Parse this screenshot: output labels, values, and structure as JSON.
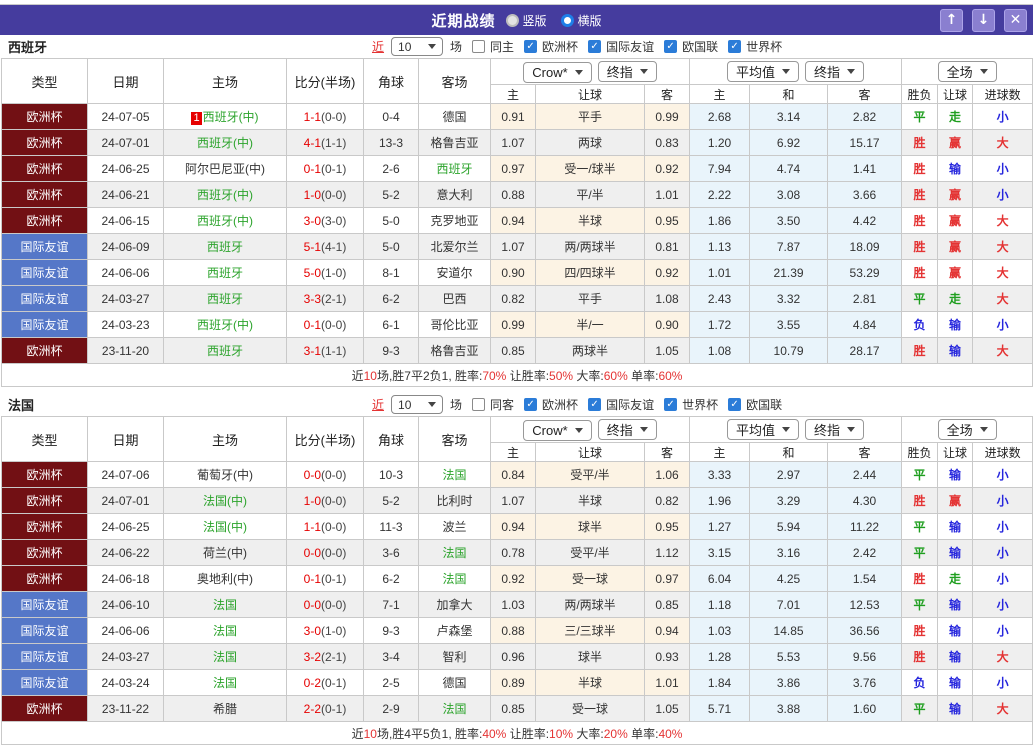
{
  "titlebar": {
    "title": "近期战绩",
    "radio1": "竖版",
    "radio2": "横版"
  },
  "icons": {
    "up": "↑",
    "down": "↓",
    "close": "✕",
    "check": "✓"
  },
  "colors": {
    "titlebar_purple": "#453C9E",
    "euro_type_maroon": "#721014",
    "friendly_type_blue": "#5577C8",
    "win_red": "#E43333",
    "draw_green": "#1E9E1E",
    "lose_blue": "#2626DD",
    "team_green": "#2BA32B",
    "score_red": "#E60000",
    "crow_col_bg": "#FCF3E4",
    "avg_col_bg": "#E9F4FB",
    "checkbox_blue": "#2B7CD8"
  },
  "table_header": {
    "main": [
      "类型",
      "日期",
      "主场",
      "比分(半场)",
      "角球",
      "客场"
    ],
    "sub": [
      "主",
      "让球",
      "客",
      "主",
      "和",
      "客",
      "胜负",
      "让球",
      "进球数"
    ],
    "dd_crow": "Crow*",
    "dd_final1": "终指",
    "dd_avg": "平均值",
    "dd_final2": "终指",
    "dd_full": "全场"
  },
  "sections": [
    {
      "team": "西班牙",
      "filter": {
        "near": "近",
        "count": "10",
        "unit": "场",
        "same": "同主",
        "leagues": [
          "欧洲杯",
          "国际友谊",
          "欧国联",
          "世界杯"
        ]
      },
      "rows": [
        {
          "type": "欧洲杯",
          "date": "24-07-05",
          "badge": "1",
          "home": "西班牙(中)",
          "hg": true,
          "ft": "1-1",
          "ht": "(0-0)",
          "corner": "0-4",
          "away": "德国",
          "ag": false,
          "o1": "0.91",
          "hc": "平手",
          "o2": "0.99",
          "a1": "2.68",
          "a2": "3.14",
          "a3": "2.82",
          "r1": "平",
          "r2": "走",
          "r3": "小"
        },
        {
          "type": "欧洲杯",
          "date": "24-07-01",
          "home": "西班牙(中)",
          "hg": true,
          "ft": "4-1",
          "ht": "(1-1)",
          "corner": "13-3",
          "away": "格鲁吉亚",
          "ag": false,
          "o1": "1.07",
          "hc": "两球",
          "o2": "0.83",
          "a1": "1.20",
          "a2": "6.92",
          "a3": "15.17",
          "r1": "胜",
          "r2": "赢",
          "r3": "大"
        },
        {
          "type": "欧洲杯",
          "date": "24-06-25",
          "home": "阿尔巴尼亚(中)",
          "hg": false,
          "ft": "0-1",
          "ht": "(0-1)",
          "corner": "2-6",
          "away": "西班牙",
          "ag": true,
          "o1": "0.97",
          "hc": "受一/球半",
          "o2": "0.92",
          "a1": "7.94",
          "a2": "4.74",
          "a3": "1.41",
          "r1": "胜",
          "r2": "输",
          "r3": "小"
        },
        {
          "type": "欧洲杯",
          "date": "24-06-21",
          "home": "西班牙(中)",
          "hg": true,
          "ft": "1-0",
          "ht": "(0-0)",
          "corner": "5-2",
          "away": "意大利",
          "ag": false,
          "o1": "0.88",
          "hc": "平/半",
          "o2": "1.01",
          "a1": "2.22",
          "a2": "3.08",
          "a3": "3.66",
          "r1": "胜",
          "r2": "赢",
          "r3": "小"
        },
        {
          "type": "欧洲杯",
          "date": "24-06-15",
          "home": "西班牙(中)",
          "hg": true,
          "ft": "3-0",
          "ht": "(3-0)",
          "corner": "5-0",
          "away": "克罗地亚",
          "ag": false,
          "o1": "0.94",
          "hc": "半球",
          "o2": "0.95",
          "a1": "1.86",
          "a2": "3.50",
          "a3": "4.42",
          "r1": "胜",
          "r2": "赢",
          "r3": "大"
        },
        {
          "type": "国际友谊",
          "date": "24-06-09",
          "home": "西班牙",
          "hg": true,
          "ft": "5-1",
          "ht": "(4-1)",
          "corner": "5-0",
          "away": "北爱尔兰",
          "ag": false,
          "o1": "1.07",
          "hc": "两/两球半",
          "o2": "0.81",
          "a1": "1.13",
          "a2": "7.87",
          "a3": "18.09",
          "r1": "胜",
          "r2": "赢",
          "r3": "大"
        },
        {
          "type": "国际友谊",
          "date": "24-06-06",
          "home": "西班牙",
          "hg": true,
          "ft": "5-0",
          "ht": "(1-0)",
          "corner": "8-1",
          "away": "安道尔",
          "ag": false,
          "o1": "0.90",
          "hc": "四/四球半",
          "o2": "0.92",
          "a1": "1.01",
          "a2": "21.39",
          "a3": "53.29",
          "r1": "胜",
          "r2": "赢",
          "r3": "大"
        },
        {
          "type": "国际友谊",
          "date": "24-03-27",
          "home": "西班牙",
          "hg": true,
          "ft": "3-3",
          "ht": "(2-1)",
          "corner": "6-2",
          "away": "巴西",
          "ag": false,
          "o1": "0.82",
          "hc": "平手",
          "o2": "1.08",
          "a1": "2.43",
          "a2": "3.32",
          "a3": "2.81",
          "r1": "平",
          "r2": "走",
          "r3": "大"
        },
        {
          "type": "国际友谊",
          "date": "24-03-23",
          "home": "西班牙(中)",
          "hg": true,
          "ft": "0-1",
          "ht": "(0-0)",
          "corner": "6-1",
          "away": "哥伦比亚",
          "ag": false,
          "o1": "0.99",
          "hc": "半/一",
          "o2": "0.90",
          "a1": "1.72",
          "a2": "3.55",
          "a3": "4.84",
          "r1": "负",
          "r2": "输",
          "r3": "小"
        },
        {
          "type": "欧洲杯",
          "date": "23-11-20",
          "home": "西班牙",
          "hg": true,
          "ft": "3-1",
          "ht": "(1-1)",
          "corner": "9-3",
          "away": "格鲁吉亚",
          "ag": false,
          "o1": "0.85",
          "hc": "两球半",
          "o2": "1.05",
          "a1": "1.08",
          "a2": "10.79",
          "a3": "28.17",
          "r1": "胜",
          "r2": "输",
          "r3": "大"
        }
      ],
      "summary": [
        "近",
        "10",
        "场,胜7平2负1, 胜率:",
        "70%",
        " 让胜率:",
        "50%",
        " 大率:",
        "60%",
        " 单率:",
        "60%"
      ]
    },
    {
      "team": "法国",
      "filter": {
        "near": "近",
        "count": "10",
        "unit": "场",
        "same": "同客",
        "leagues": [
          "欧洲杯",
          "国际友谊",
          "世界杯",
          "欧国联"
        ]
      },
      "rows": [
        {
          "type": "欧洲杯",
          "date": "24-07-06",
          "home": "葡萄牙(中)",
          "hg": false,
          "ft": "0-0",
          "ht": "(0-0)",
          "corner": "10-3",
          "away": "法国",
          "ag": true,
          "o1": "0.84",
          "hc": "受平/半",
          "o2": "1.06",
          "a1": "3.33",
          "a2": "2.97",
          "a3": "2.44",
          "r1": "平",
          "r2": "输",
          "r3": "小"
        },
        {
          "type": "欧洲杯",
          "date": "24-07-01",
          "home": "法国(中)",
          "hg": true,
          "ft": "1-0",
          "ht": "(0-0)",
          "corner": "5-2",
          "away": "比利时",
          "ag": false,
          "o1": "1.07",
          "hc": "半球",
          "o2": "0.82",
          "a1": "1.96",
          "a2": "3.29",
          "a3": "4.30",
          "r1": "胜",
          "r2": "赢",
          "r3": "小"
        },
        {
          "type": "欧洲杯",
          "date": "24-06-25",
          "home": "法国(中)",
          "hg": true,
          "ft": "1-1",
          "ht": "(0-0)",
          "corner": "11-3",
          "away": "波兰",
          "ag": false,
          "o1": "0.94",
          "hc": "球半",
          "o2": "0.95",
          "a1": "1.27",
          "a2": "5.94",
          "a3": "11.22",
          "r1": "平",
          "r2": "输",
          "r3": "小"
        },
        {
          "type": "欧洲杯",
          "date": "24-06-22",
          "home": "荷兰(中)",
          "hg": false,
          "ft": "0-0",
          "ht": "(0-0)",
          "corner": "3-6",
          "away": "法国",
          "ag": true,
          "o1": "0.78",
          "hc": "受平/半",
          "o2": "1.12",
          "a1": "3.15",
          "a2": "3.16",
          "a3": "2.42",
          "r1": "平",
          "r2": "输",
          "r3": "小"
        },
        {
          "type": "欧洲杯",
          "date": "24-06-18",
          "home": "奥地利(中)",
          "hg": false,
          "ft": "0-1",
          "ht": "(0-1)",
          "corner": "6-2",
          "away": "法国",
          "ag": true,
          "o1": "0.92",
          "hc": "受一球",
          "o2": "0.97",
          "a1": "6.04",
          "a2": "4.25",
          "a3": "1.54",
          "r1": "胜",
          "r2": "走",
          "r3": "小"
        },
        {
          "type": "国际友谊",
          "date": "24-06-10",
          "home": "法国",
          "hg": true,
          "ft": "0-0",
          "ht": "(0-0)",
          "corner": "7-1",
          "away": "加拿大",
          "ag": false,
          "o1": "1.03",
          "hc": "两/两球半",
          "o2": "0.85",
          "a1": "1.18",
          "a2": "7.01",
          "a3": "12.53",
          "r1": "平",
          "r2": "输",
          "r3": "小"
        },
        {
          "type": "国际友谊",
          "date": "24-06-06",
          "home": "法国",
          "hg": true,
          "ft": "3-0",
          "ht": "(1-0)",
          "corner": "9-3",
          "away": "卢森堡",
          "ag": false,
          "o1": "0.88",
          "hc": "三/三球半",
          "o2": "0.94",
          "a1": "1.03",
          "a2": "14.85",
          "a3": "36.56",
          "r1": "胜",
          "r2": "输",
          "r3": "小"
        },
        {
          "type": "国际友谊",
          "date": "24-03-27",
          "home": "法国",
          "hg": true,
          "ft": "3-2",
          "ht": "(2-1)",
          "corner": "3-4",
          "away": "智利",
          "ag": false,
          "o1": "0.96",
          "hc": "球半",
          "o2": "0.93",
          "a1": "1.28",
          "a2": "5.53",
          "a3": "9.56",
          "r1": "胜",
          "r2": "输",
          "r3": "大"
        },
        {
          "type": "国际友谊",
          "date": "24-03-24",
          "home": "法国",
          "hg": true,
          "ft": "0-2",
          "ht": "(0-1)",
          "corner": "2-5",
          "away": "德国",
          "ag": false,
          "o1": "0.89",
          "hc": "半球",
          "o2": "1.01",
          "a1": "1.84",
          "a2": "3.86",
          "a3": "3.76",
          "r1": "负",
          "r2": "输",
          "r3": "小"
        },
        {
          "type": "欧洲杯",
          "date": "23-11-22",
          "home": "希腊",
          "hg": false,
          "ft": "2-2",
          "ht": "(0-1)",
          "corner": "2-9",
          "away": "法国",
          "ag": true,
          "o1": "0.85",
          "hc": "受一球",
          "o2": "1.05",
          "a1": "5.71",
          "a2": "3.88",
          "a3": "1.60",
          "r1": "平",
          "r2": "输",
          "r3": "大"
        }
      ],
      "summary": [
        "近",
        "10",
        "场,胜4平5负1, 胜率:",
        "40%",
        " 让胜率:",
        "10%",
        " 大率:",
        "20%",
        " 单率:",
        "40%"
      ]
    }
  ]
}
